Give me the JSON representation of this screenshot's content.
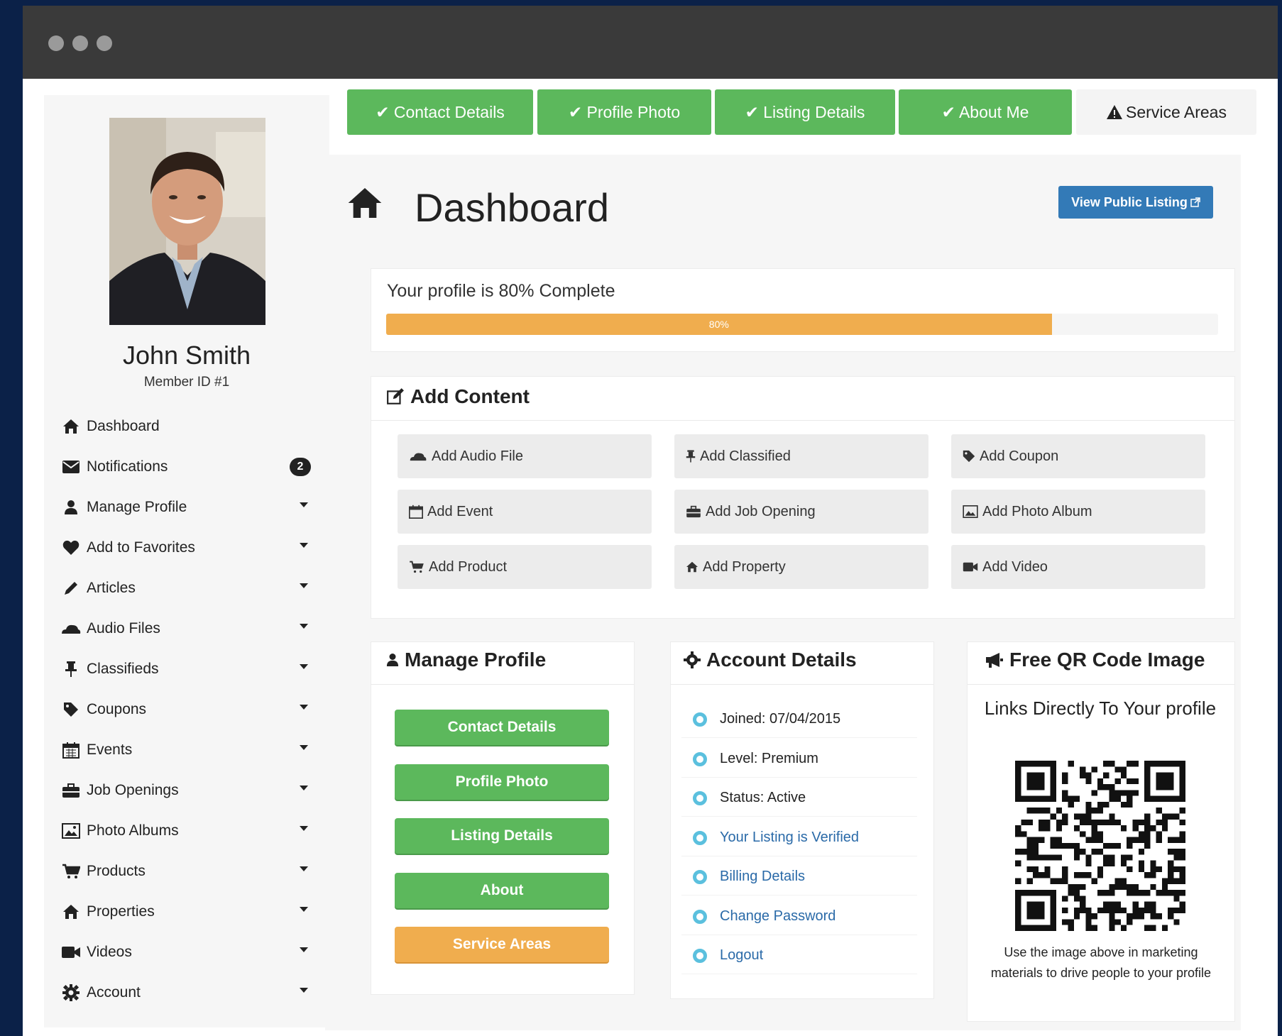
{
  "window": {
    "dots": [
      "red",
      "yellow",
      "green"
    ]
  },
  "user": {
    "name": "John Smith",
    "member_id": "Member ID #1"
  },
  "sidebar": {
    "items": [
      {
        "label": "Dashboard",
        "icon": "home-icon"
      },
      {
        "label": "Notifications",
        "icon": "envelope-icon",
        "badge": "2"
      },
      {
        "label": "Manage Profile",
        "icon": "user-icon",
        "caret": true
      },
      {
        "label": "Add to Favorites",
        "icon": "heart-icon",
        "caret": true
      },
      {
        "label": "Articles",
        "icon": "pencil-icon",
        "caret": true
      },
      {
        "label": "Audio Files",
        "icon": "cloud-icon",
        "caret": true
      },
      {
        "label": "Classifieds",
        "icon": "pushpin-icon",
        "caret": true
      },
      {
        "label": "Coupons",
        "icon": "tag-icon",
        "caret": true
      },
      {
        "label": "Events",
        "icon": "calendar-icon",
        "caret": true
      },
      {
        "label": "Job Openings",
        "icon": "briefcase-icon",
        "caret": true
      },
      {
        "label": "Photo Albums",
        "icon": "picture-icon",
        "caret": true
      },
      {
        "label": "Products",
        "icon": "cart-icon",
        "caret": true
      },
      {
        "label": "Properties",
        "icon": "home-icon",
        "caret": true
      },
      {
        "label": "Videos",
        "icon": "video-icon",
        "caret": true
      },
      {
        "label": "Account",
        "icon": "gear-icon",
        "caret": true
      }
    ]
  },
  "tabs": [
    {
      "label": "✔ Contact Details",
      "state": "complete"
    },
    {
      "label": "✔ Profile Photo",
      "state": "complete"
    },
    {
      "label": "✔ Listing Details",
      "state": "complete"
    },
    {
      "label": "✔ About Me",
      "state": "complete"
    },
    {
      "label": "Service Areas",
      "state": "warning"
    }
  ],
  "main": {
    "title": "Dashboard",
    "view_public_listing": "View Public Listing"
  },
  "progress": {
    "label": "Your profile is 80% Complete",
    "value": 0.8,
    "bar_text": "80%",
    "color": "#f0ad4e"
  },
  "add_content": {
    "title": "Add Content",
    "buttons": [
      {
        "label": "Add Audio File",
        "icon": "cloud-icon"
      },
      {
        "label": "Add Classified",
        "icon": "pushpin-icon"
      },
      {
        "label": "Add Coupon",
        "icon": "tag-icon"
      },
      {
        "label": "Add Event",
        "icon": "calendar-icon"
      },
      {
        "label": "Add Job Opening",
        "icon": "briefcase-icon"
      },
      {
        "label": "Add Photo Album",
        "icon": "picture-icon"
      },
      {
        "label": "Add Product",
        "icon": "cart-icon"
      },
      {
        "label": "Add Property",
        "icon": "home-icon"
      },
      {
        "label": "Add Video",
        "icon": "video-icon"
      }
    ]
  },
  "manage_profile": {
    "title": "Manage Profile",
    "buttons": [
      "Contact Details",
      "Profile Photo",
      "Listing Details",
      "About",
      "Service Areas"
    ]
  },
  "account_details": {
    "title": "Account Details",
    "rows": [
      {
        "text": "Joined: 07/04/2015",
        "link": false
      },
      {
        "text": "Level: Premium",
        "link": false
      },
      {
        "text": "Status: Active",
        "link": false
      },
      {
        "text": "Your Listing is Verified",
        "link": true
      },
      {
        "text": "Billing Details",
        "link": true
      },
      {
        "text": "Change Password",
        "link": true
      },
      {
        "text": "Logout",
        "link": true
      }
    ]
  },
  "qr": {
    "title": "Free QR Code Image",
    "subtitle": "Links Directly To Your profile",
    "note": "Use the image above in marketing materials to drive people to your profile"
  },
  "colors": {
    "success": "#5cb85c",
    "warning": "#f0ad4e",
    "primary": "#337ab7",
    "info": "#5bc0de"
  }
}
